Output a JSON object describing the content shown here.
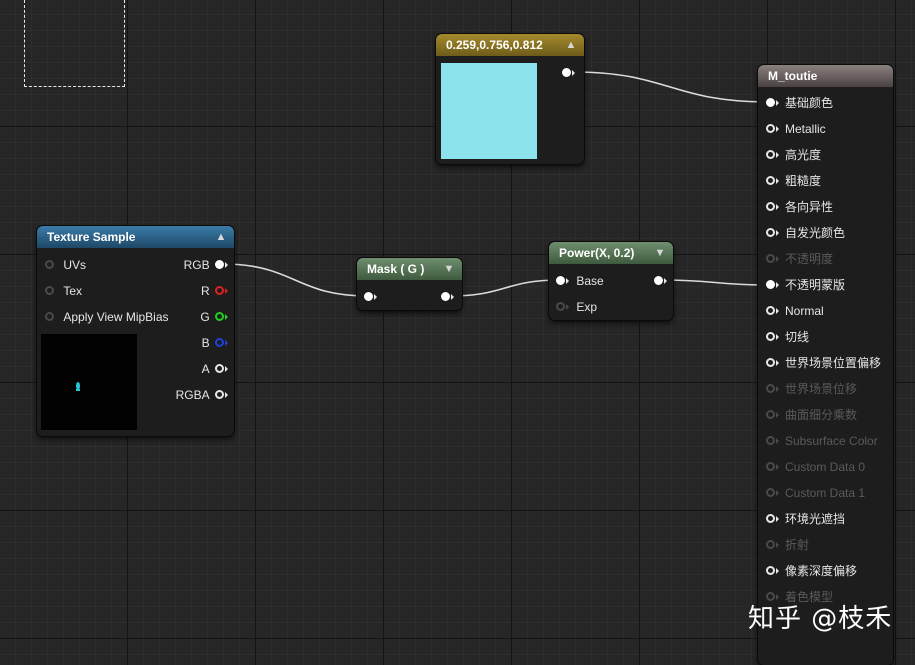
{
  "color_node": {
    "title": "0.259,0.756,0.812",
    "swatch_color": "#8ce3ec"
  },
  "texture_sample": {
    "title": "Texture Sample",
    "inputs": [
      "UVs",
      "Tex",
      "Apply View MipBias"
    ],
    "outputs": [
      "RGB",
      "R",
      "G",
      "B",
      "A",
      "RGBA"
    ]
  },
  "mask_node": {
    "title": "Mask ( G )"
  },
  "power_node": {
    "title": "Power(X, 0.2)",
    "inputs": [
      "Base",
      "Exp"
    ]
  },
  "material_node": {
    "title": "M_toutie",
    "pins": [
      {
        "label": "基础颜色",
        "state": "connected"
      },
      {
        "label": "Metallic",
        "state": "active"
      },
      {
        "label": "高光度",
        "state": "active"
      },
      {
        "label": "粗糙度",
        "state": "active"
      },
      {
        "label": "各向异性",
        "state": "active"
      },
      {
        "label": "自发光颜色",
        "state": "active"
      },
      {
        "label": "不透明度",
        "state": "disabled"
      },
      {
        "label": "不透明蒙版",
        "state": "connected"
      },
      {
        "label": "Normal",
        "state": "active"
      },
      {
        "label": "切线",
        "state": "active"
      },
      {
        "label": "世界场景位置偏移",
        "state": "active"
      },
      {
        "label": "世界场景位移",
        "state": "disabled"
      },
      {
        "label": "曲面细分乘数",
        "state": "disabled"
      },
      {
        "label": "Subsurface Color",
        "state": "disabled"
      },
      {
        "label": "Custom Data 0",
        "state": "disabled"
      },
      {
        "label": "Custom Data 1",
        "state": "disabled"
      },
      {
        "label": "环境光遮挡",
        "state": "active"
      },
      {
        "label": "折射",
        "state": "disabled"
      },
      {
        "label": "像素深度偏移",
        "state": "active"
      },
      {
        "label": "着色模型",
        "state": "disabled"
      }
    ]
  },
  "watermark": "知乎 @枝禾",
  "colors": {
    "texture_header": "#2a5f86",
    "mask_header": "#4c6b4c",
    "color_header": "#8a7425",
    "material_header": "#6e6463",
    "wire": "#dcdcdc"
  }
}
